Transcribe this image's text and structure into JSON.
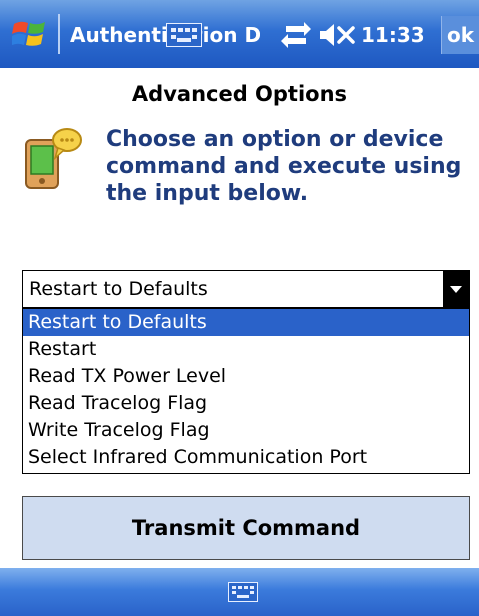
{
  "titlebar": {
    "title": "Authentication De",
    "clock": "11:33",
    "ok_label": "ok",
    "color": "#2f6fd2"
  },
  "content": {
    "page_title": "Advanced Options",
    "instructions": "Choose an option or device command and execute using the input below."
  },
  "combo": {
    "selected_value": "Restart to Defaults",
    "options": [
      "Restart to Defaults",
      "Restart",
      "Read TX Power Level",
      "Read Tracelog Flag",
      "Write Tracelog Flag",
      "Select Infrared Communication Port"
    ],
    "highlighted_index": 0,
    "highlight_color": "#2a62c9"
  },
  "actions": {
    "transmit_label": "Transmit Command"
  },
  "icons": {
    "start": "windows-flag-icon",
    "sync": "sync-arrows-icon",
    "volume": "volume-muted-icon",
    "device": "pda-message-icon",
    "keyboard": "keyboard-icon"
  }
}
